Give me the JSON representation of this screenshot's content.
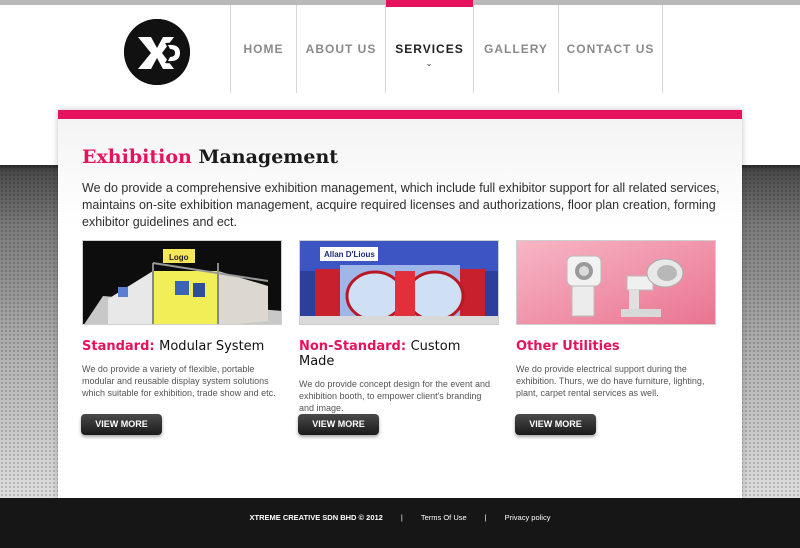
{
  "header": {
    "logo_text": "XC",
    "nav": [
      {
        "label": "HOME",
        "active": false
      },
      {
        "label": "ABOUT US",
        "active": false
      },
      {
        "label": "SERVICES",
        "active": true
      },
      {
        "label": "GALLERY",
        "active": false
      },
      {
        "label": "CONTACT US",
        "active": false
      }
    ]
  },
  "main": {
    "title_accent": "Exhibition",
    "title_rest": "Management",
    "intro": "We do provide a comprehensive exhibition management, which include full exhibitor support for all related services, maintains on-site exhibition management, acquire required licenses and authorizations, floor plan creation, forming exhibitor guidelines and ect.",
    "cards": [
      {
        "title_accent": "Standard:",
        "title_rest": "Modular System",
        "text": "We do provide a variety of flexible, portable modular and reusable display system solutions which suitable for exhibition, trade show and etc.",
        "button": "VIEW MORE",
        "image_sign": "Logo"
      },
      {
        "title_accent": "Non-Standard:",
        "title_rest": "Custom Made",
        "text": "We do provide concept design for the event and exhibition booth, to empower client's branding and image.",
        "button": "VIEW MORE",
        "image_sign": "Allan D'Lious"
      },
      {
        "title_accent": "Other Utilities",
        "title_rest": "",
        "text": "We do provide electrical support during the exhibition. Thurs, we do have furniture, lighting, plant, carpet rental services as well.",
        "button": "VIEW MORE",
        "image_sign": ""
      }
    ]
  },
  "footer": {
    "copyright": "XTREME CREATIVE SDN BHD © 2012",
    "separator": "|",
    "terms": "Terms Of Use",
    "privacy": "Privacy policy"
  },
  "colors": {
    "accent": "#e6125d",
    "footer_bg": "#161616",
    "button_bg": "#2a2a2a"
  }
}
